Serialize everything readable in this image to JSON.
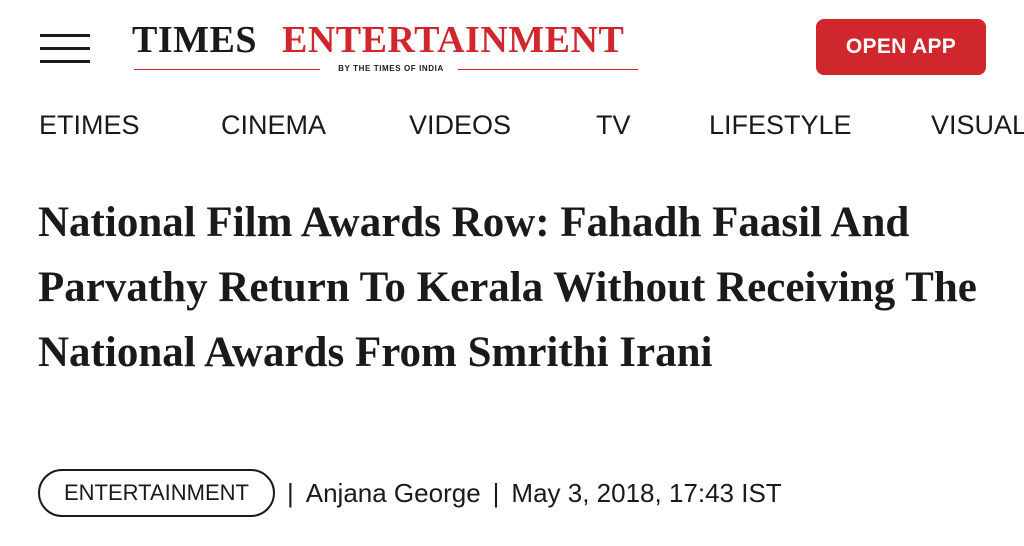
{
  "header": {
    "logo_times": "TIMES",
    "logo_entertainment": "ENTERTAINMENT",
    "logo_subtitle": "BY THE TIMES OF INDIA",
    "open_app_label": "OPEN APP"
  },
  "nav": {
    "items": [
      "ETIMES",
      "CINEMA",
      "VIDEOS",
      "TV",
      "LIFESTYLE",
      "VISUAL"
    ]
  },
  "article": {
    "headline": "National Film Awards Row: Fahadh Faasil And Parvathy Return To Kerala Without Receiving The National Awards From Smrithi Irani",
    "category": "ENTERTAINMENT",
    "separator": "|",
    "author": "Anjana George",
    "date": "May 3, 2018, 17:43 IST"
  },
  "colors": {
    "brand_red": "#d0262d",
    "text": "#1a1a1a",
    "background": "#ffffff"
  }
}
